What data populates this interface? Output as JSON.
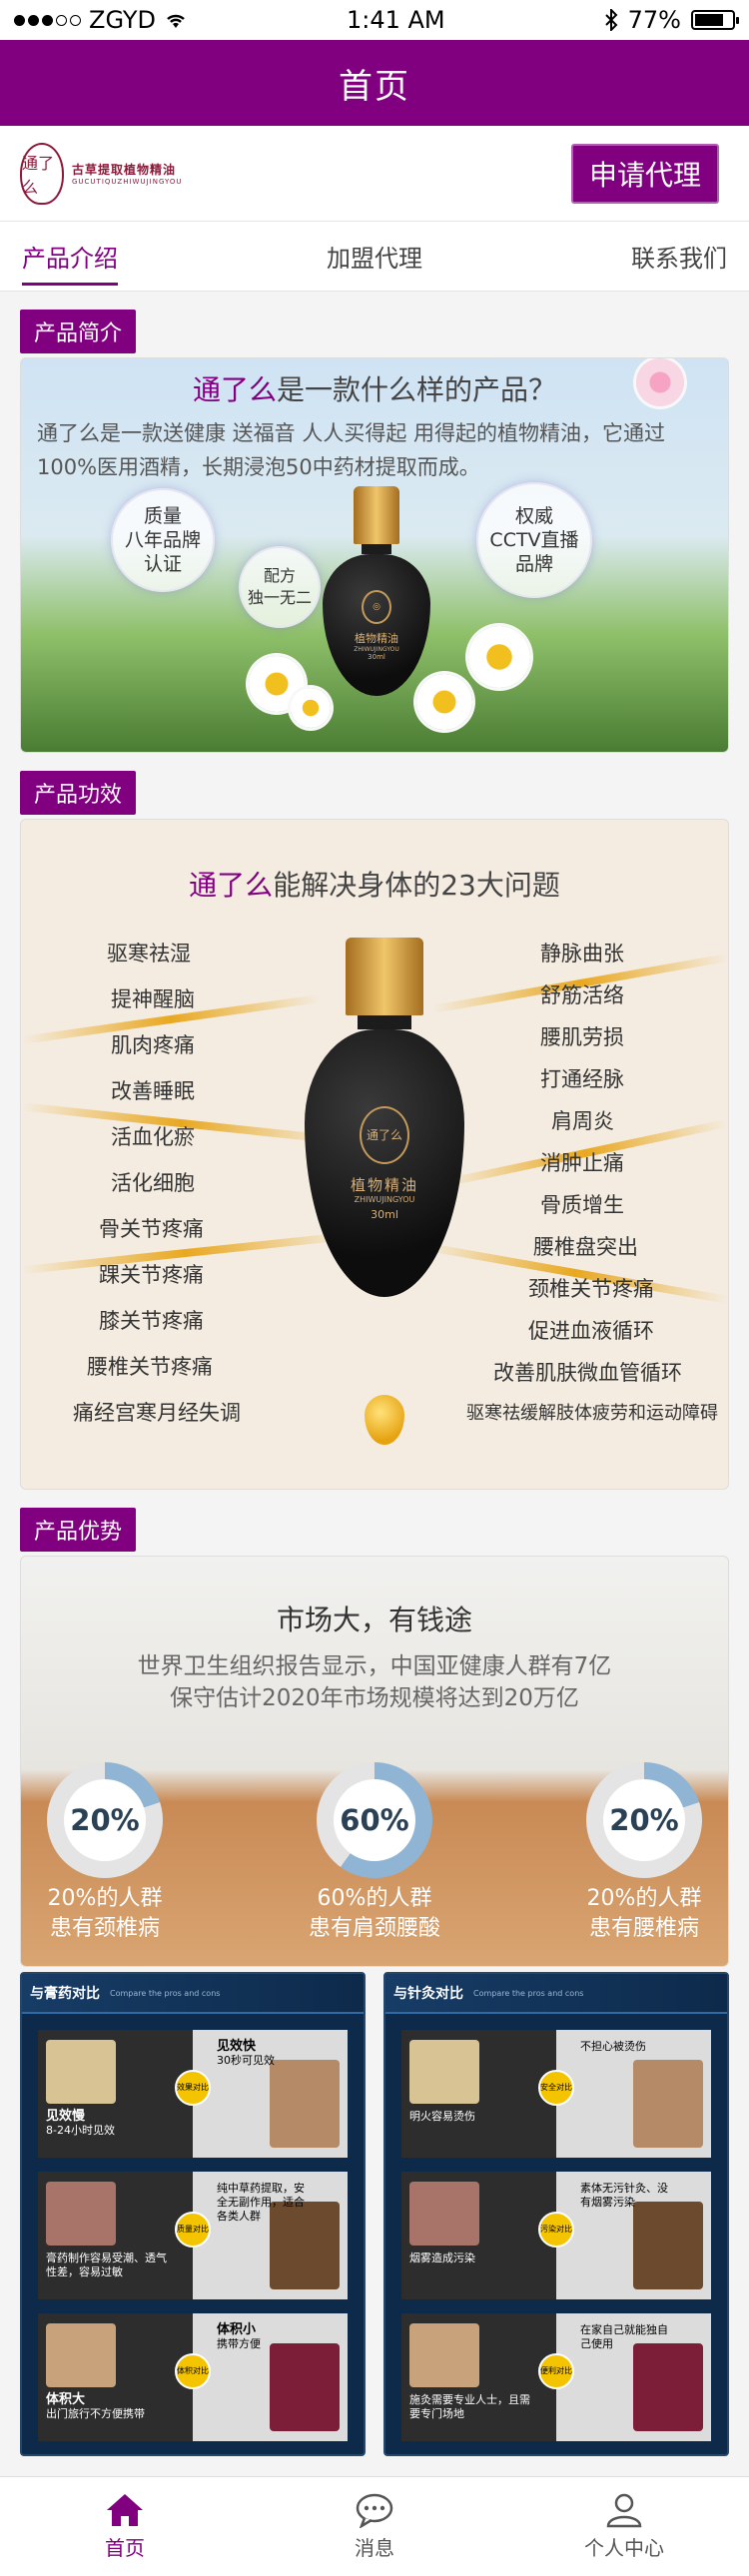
{
  "status_bar": {
    "carrier": "ZGYD",
    "time": "1:41 AM",
    "battery": "77%",
    "battery_level": 0.77
  },
  "header": {
    "title": "首页"
  },
  "brand": {
    "seal_text": "通了么",
    "name_cn": "古草提取植物精油",
    "name_en": "GUCUTIQUZHIWUJINGYOU",
    "apply_button": "申请代理"
  },
  "tabs": [
    {
      "label": "产品介绍",
      "active": true
    },
    {
      "label": "加盟代理",
      "active": false
    },
    {
      "label": "联系我们",
      "active": false
    }
  ],
  "intro": {
    "section_label": "产品简介",
    "headline_brand": "通了么",
    "headline_rest": "是一款什么样的产品？",
    "description": "通了么是一款送健康  送福音  人人买得起  用得起的植物精油，它通过100%医用酒精，长期浸泡50中药材提取而成。",
    "bubbles": [
      {
        "line1": "质量",
        "line2": "八年品牌",
        "line3": "认证"
      },
      {
        "line1": "配方",
        "line2": "独一无二",
        "line3": ""
      },
      {
        "line1": "权威",
        "line2": "CCTV直播",
        "line3": "品牌"
      }
    ],
    "bottle_label": "植物精油",
    "bottle_sub": "ZHIWUJINGYOU",
    "bottle_volume": "30ml"
  },
  "efficacy": {
    "section_label": "产品功效",
    "headline_brand": "通了么",
    "headline_rest": "能解决身体的23大问题",
    "left_items": [
      "驱寒祛湿",
      "提神醒脑",
      "肌肉疼痛",
      "改善睡眠",
      "活血化瘀",
      "活化细胞",
      "骨关节疼痛",
      "踝关节疼痛",
      "膝关节疼痛",
      "腰椎关节疼痛",
      "痛经宫寒月经失调"
    ],
    "right_items": [
      "静脉曲张",
      "舒筋活络",
      "腰肌劳损",
      "打通经脉",
      "肩周炎",
      "消肿止痛",
      "骨质增生",
      "腰椎盘突出",
      "颈椎关节疼痛",
      "促进血液循环",
      "改善肌肤微血管循环",
      "驱寒祛缓解肢体疲劳和运动障碍"
    ],
    "bottle_seal": "通了么",
    "bottle_label": "植物精油",
    "bottle_sub": "ZHIWUJINGYOU",
    "bottle_volume": "30ml"
  },
  "advantage": {
    "section_label": "产品优势",
    "headline": "市场大，有钱途",
    "desc_line1": "世界卫生组织报告显示，中国亚健康人群有7亿",
    "desc_line2": "保守估计2020年市场规模将达到20万亿",
    "stats": [
      {
        "value": "20%",
        "fraction": 0.2,
        "line1": "20%的人群",
        "line2": "患有颈椎病"
      },
      {
        "value": "60%",
        "fraction": 0.6,
        "line1": "60%的人群",
        "line2": "患有肩颈腰酸"
      },
      {
        "value": "20%",
        "fraction": 0.2,
        "line1": "20%的人群",
        "line2": "患有腰椎病"
      }
    ]
  },
  "compare": [
    {
      "title": "与膏药对比",
      "subtitle": "Compare the pros and cons",
      "rows": [
        {
          "badge": "效果对比",
          "left_title": "见效慢",
          "left_sub": "8-24小时见效",
          "right_title": "见效快",
          "right_sub": "30秒可见效"
        },
        {
          "badge": "质量对比",
          "left_title": "",
          "left_sub": "膏药制作容易受潮、透气性差，容易过敏",
          "right_title": "",
          "right_sub": "纯中草药提取，安全无副作用，适合各类人群"
        },
        {
          "badge": "体积对比",
          "left_title": "体积大",
          "left_sub": "出门旅行不方便携带",
          "right_title": "体积小",
          "right_sub": "携带方便"
        }
      ]
    },
    {
      "title": "与针灸对比",
      "subtitle": "Compare the pros and cons",
      "rows": [
        {
          "badge": "安全对比",
          "left_title": "",
          "left_sub": "明火容易烫伤",
          "right_title": "",
          "right_sub": "不担心被烫伤"
        },
        {
          "badge": "污染对比",
          "left_title": "",
          "left_sub": "烟雾造成污染",
          "right_title": "",
          "right_sub": "素体无污针灸、没有烟雾污染"
        },
        {
          "badge": "便利对比",
          "left_title": "",
          "left_sub": "施灸需要专业人士，且需要专门场地",
          "right_title": "",
          "right_sub": "在家自己就能独自己使用"
        }
      ]
    }
  ],
  "bottom_nav": [
    {
      "label": "首页",
      "icon": "home-icon",
      "active": true
    },
    {
      "label": "消息",
      "icon": "message-icon",
      "active": false
    },
    {
      "label": "个人中心",
      "icon": "user-icon",
      "active": false
    }
  ],
  "colors": {
    "primary": "#800080",
    "gold": "#e6a210",
    "ring_blue": "#8fb4d4"
  }
}
